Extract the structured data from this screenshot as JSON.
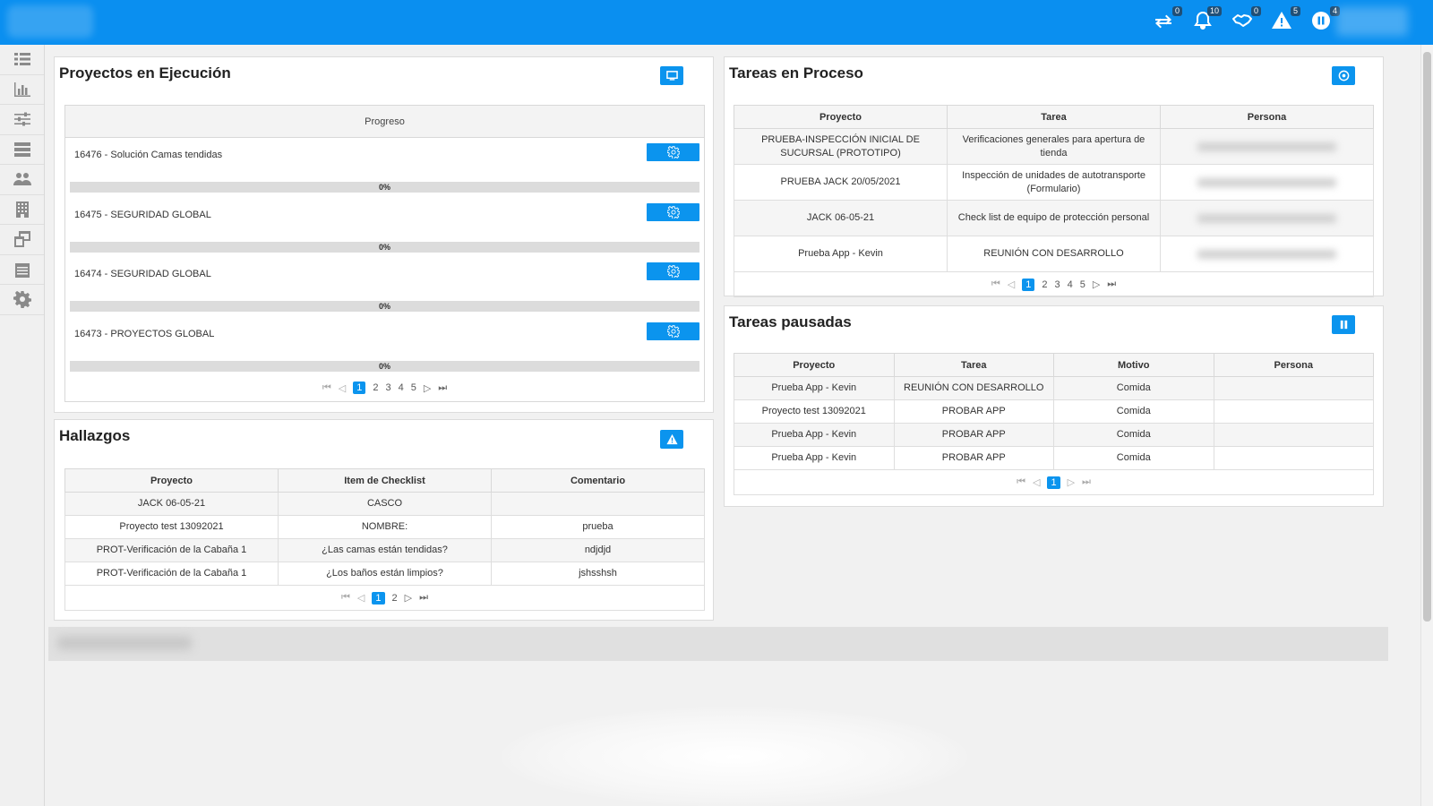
{
  "header": {
    "notifications": [
      {
        "icon": "transfer-icon",
        "count": "0"
      },
      {
        "icon": "bell-icon",
        "count": "10"
      },
      {
        "icon": "handshake-icon",
        "count": "0"
      },
      {
        "icon": "warning-icon",
        "count": "5"
      },
      {
        "icon": "pause-circle-icon",
        "count": "4"
      }
    ]
  },
  "sidebar": {
    "items": [
      {
        "icon": "list-icon"
      },
      {
        "icon": "bar-chart-icon"
      },
      {
        "icon": "sliders-icon"
      },
      {
        "icon": "layers-icon"
      },
      {
        "icon": "users-icon"
      },
      {
        "icon": "building-icon"
      },
      {
        "icon": "windows-icon"
      },
      {
        "icon": "calendar-icon"
      },
      {
        "icon": "gear-icon"
      }
    ]
  },
  "proyectos": {
    "title": "Proyectos en Ejecución",
    "column": "Progreso",
    "rows": [
      {
        "name": "16476 - Solución Camas tendidas",
        "progress": 0,
        "progress_label": "0%"
      },
      {
        "name": "16475 - SEGURIDAD GLOBAL",
        "progress": 0,
        "progress_label": "0%"
      },
      {
        "name": "16474 - SEGURIDAD GLOBAL",
        "progress": 0,
        "progress_label": "0%"
      },
      {
        "name": "16473 - PROYECTOS GLOBAL",
        "progress": 0,
        "progress_label": "0%"
      }
    ],
    "pages": [
      "1",
      "2",
      "3",
      "4",
      "5"
    ]
  },
  "hallazgos": {
    "title": "Hallazgos",
    "columns": [
      "Proyecto",
      "Item de Checklist",
      "Comentario"
    ],
    "rows": [
      [
        "JACK 06-05-21",
        "CASCO",
        ""
      ],
      [
        "Proyecto test 13092021",
        "NOMBRE:",
        "prueba"
      ],
      [
        "PROT-Verificación de la Cabaña 1",
        "¿Las camas están tendidas?",
        "ndjdjd"
      ],
      [
        "PROT-Verificación de la Cabaña 1",
        "¿Los baños están limpios?",
        "jshsshsh"
      ]
    ],
    "pages": [
      "1",
      "2"
    ]
  },
  "tareas_proceso": {
    "title": "Tareas en Proceso",
    "columns": [
      "Proyecto",
      "Tarea",
      "Persona"
    ],
    "rows": [
      [
        "PRUEBA-INSPECCIÓN INICIAL DE SUCURSAL (PROTOTIPO)",
        "Verificaciones generales para apertura de tienda",
        ""
      ],
      [
        "PRUEBA JACK 20/05/2021",
        "Inspección de unidades de autotransporte (Formulario)",
        ""
      ],
      [
        "JACK 06-05-21",
        "Check list de equipo de protección personal",
        ""
      ],
      [
        "Prueba App - Kevin",
        "REUNIÓN CON DESARROLLO",
        ""
      ]
    ],
    "pages": [
      "1",
      "2",
      "3",
      "4",
      "5"
    ]
  },
  "tareas_pausadas": {
    "title": "Tareas pausadas",
    "columns": [
      "Proyecto",
      "Tarea",
      "Motivo",
      "Persona"
    ],
    "rows": [
      [
        "Prueba App - Kevin",
        "REUNIÓN CON DESARROLLO",
        "Comida",
        ""
      ],
      [
        "Proyecto test 13092021",
        "PROBAR APP",
        "Comida",
        ""
      ],
      [
        "Prueba App - Kevin",
        "PROBAR APP",
        "Comida",
        ""
      ],
      [
        "Prueba App - Kevin",
        "PROBAR APP",
        "Comida",
        ""
      ]
    ],
    "pages": [
      "1"
    ]
  },
  "colors": {
    "topbar": "#0a8ff0",
    "accent": "#0b94ee"
  }
}
